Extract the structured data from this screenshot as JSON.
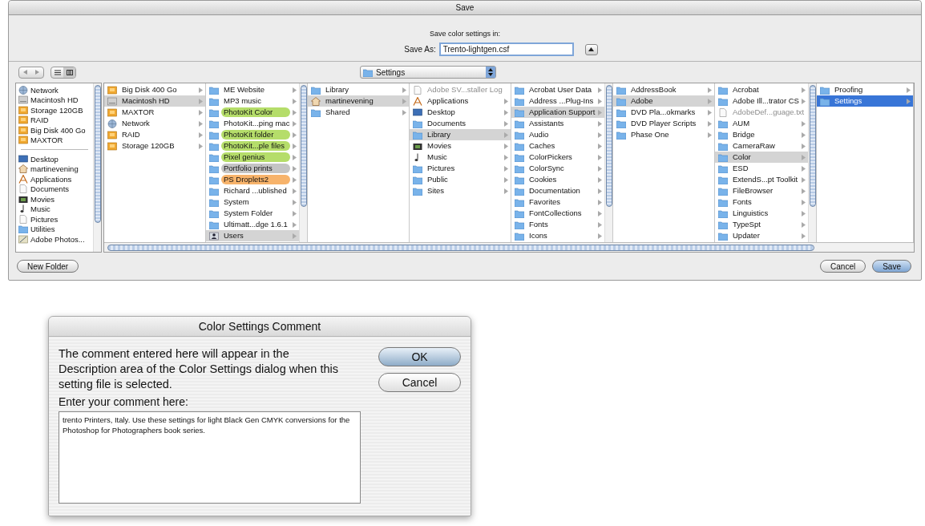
{
  "window": {
    "title": "Save"
  },
  "header": {
    "prompt": "Save color settings in:",
    "save_as_label": "Save As:",
    "filename": "Trento-lightgen.csf"
  },
  "location_popup": {
    "label": "Settings"
  },
  "sidebar": {
    "devices": [
      {
        "name": "Network",
        "kind": "network"
      },
      {
        "name": "Macintosh HD",
        "kind": "disk"
      },
      {
        "name": "Storage 120GB",
        "kind": "drive"
      },
      {
        "name": "RAID",
        "kind": "drive"
      },
      {
        "name": "Big Disk 400 Go",
        "kind": "drive"
      },
      {
        "name": "MAXTOR",
        "kind": "drive"
      }
    ],
    "places": [
      {
        "name": "Desktop",
        "kind": "desktop"
      },
      {
        "name": "martinevening",
        "kind": "home"
      },
      {
        "name": "Applications",
        "kind": "applications"
      },
      {
        "name": "Documents",
        "kind": "file"
      },
      {
        "name": "Movies",
        "kind": "movies"
      },
      {
        "name": "Music",
        "kind": "music"
      },
      {
        "name": "Pictures",
        "kind": "file"
      },
      {
        "name": "Utilities",
        "kind": "folder"
      },
      {
        "name": "Adobe Photos...",
        "kind": "app"
      }
    ]
  },
  "columns": [
    {
      "scrollable": false,
      "items": [
        {
          "name": "Big Disk 400 Go",
          "kind": "drive",
          "selected": false
        },
        {
          "name": "Macintosh HD",
          "kind": "disk",
          "selected": true
        },
        {
          "name": "MAXTOR",
          "kind": "drive",
          "selected": false
        },
        {
          "name": "Network",
          "kind": "network",
          "selected": false
        },
        {
          "name": "RAID",
          "kind": "drive",
          "selected": false
        },
        {
          "name": "Storage 120GB",
          "kind": "drive",
          "selected": false
        }
      ]
    },
    {
      "scrollable": true,
      "items": [
        {
          "name": "ME Website",
          "kind": "folder",
          "selected": false
        },
        {
          "name": "MP3 music",
          "kind": "folder",
          "selected": false
        },
        {
          "name": "PhotoKit Color",
          "kind": "folder",
          "selected": false,
          "color": "#b5dd6a"
        },
        {
          "name": "PhotoKit...ping mac",
          "kind": "folder",
          "selected": false
        },
        {
          "name": "PhotoKit folder",
          "kind": "folder",
          "selected": false,
          "color": "#b5dd6a"
        },
        {
          "name": "PhotoKit...ple files",
          "kind": "folder",
          "selected": false,
          "color": "#b5dd6a"
        },
        {
          "name": "Pixel genius",
          "kind": "folder",
          "selected": false,
          "color": "#b5dd6a"
        },
        {
          "name": "Portfolio prints",
          "kind": "folder",
          "selected": false,
          "color": "#c4c4c4"
        },
        {
          "name": "PS Droplets2",
          "kind": "folder",
          "selected": false,
          "color": "#f7b36b"
        },
        {
          "name": "Richard ...ublished",
          "kind": "folder",
          "selected": false
        },
        {
          "name": "System",
          "kind": "folder",
          "selected": false
        },
        {
          "name": "System Folder",
          "kind": "folder",
          "selected": false
        },
        {
          "name": "Ultimatt...dge 1.6.1",
          "kind": "folder",
          "selected": false
        },
        {
          "name": "Users",
          "kind": "users",
          "selected": true
        }
      ]
    },
    {
      "scrollable": false,
      "items": [
        {
          "name": "Library",
          "kind": "folder",
          "selected": false
        },
        {
          "name": "martinevening",
          "kind": "home",
          "selected": true
        },
        {
          "name": "Shared",
          "kind": "folder",
          "selected": false
        }
      ]
    },
    {
      "scrollable": false,
      "items": [
        {
          "name": "Adobe SV...staller Log",
          "kind": "file",
          "selected": false
        },
        {
          "name": "Applications",
          "kind": "applications",
          "selected": false
        },
        {
          "name": "Desktop",
          "kind": "desktop",
          "selected": false
        },
        {
          "name": "Documents",
          "kind": "folder",
          "selected": false
        },
        {
          "name": "Library",
          "kind": "folder",
          "selected": true
        },
        {
          "name": "Movies",
          "kind": "movies",
          "selected": false
        },
        {
          "name": "Music",
          "kind": "music",
          "selected": false
        },
        {
          "name": "Pictures",
          "kind": "folder",
          "selected": false
        },
        {
          "name": "Public",
          "kind": "folder",
          "selected": false
        },
        {
          "name": "Sites",
          "kind": "folder",
          "selected": false
        }
      ]
    },
    {
      "scrollable": true,
      "items": [
        {
          "name": "Acrobat User Data",
          "kind": "folder",
          "selected": false
        },
        {
          "name": "Address ...Plug-Ins",
          "kind": "folder",
          "selected": false
        },
        {
          "name": "Application Support",
          "kind": "folder",
          "selected": true
        },
        {
          "name": "Assistants",
          "kind": "folder",
          "selected": false
        },
        {
          "name": "Audio",
          "kind": "folder",
          "selected": false
        },
        {
          "name": "Caches",
          "kind": "folder",
          "selected": false
        },
        {
          "name": "ColorPickers",
          "kind": "folder",
          "selected": false
        },
        {
          "name": "ColorSync",
          "kind": "folder",
          "selected": false
        },
        {
          "name": "Cookies",
          "kind": "folder",
          "selected": false
        },
        {
          "name": "Documentation",
          "kind": "folder",
          "selected": false
        },
        {
          "name": "Favorites",
          "kind": "folder",
          "selected": false
        },
        {
          "name": "FontCollections",
          "kind": "folder",
          "selected": false
        },
        {
          "name": "Fonts",
          "kind": "folder",
          "selected": false
        },
        {
          "name": "Icons",
          "kind": "folder",
          "selected": false
        }
      ]
    },
    {
      "scrollable": false,
      "items": [
        {
          "name": "AddressBook",
          "kind": "folder",
          "selected": false
        },
        {
          "name": "Adobe",
          "kind": "folder",
          "selected": true
        },
        {
          "name": "DVD Pla...okmarks",
          "kind": "folder",
          "selected": false
        },
        {
          "name": "DVD Player Scripts",
          "kind": "folder",
          "selected": false
        },
        {
          "name": "Phase One",
          "kind": "folder",
          "selected": false
        }
      ]
    },
    {
      "scrollable": true,
      "items": [
        {
          "name": "Acrobat",
          "kind": "folder",
          "selected": false
        },
        {
          "name": "Adobe Ill...trator CS",
          "kind": "folder",
          "selected": false
        },
        {
          "name": "AdobeDef...guage.txt",
          "kind": "file",
          "selected": false
        },
        {
          "name": "AUM",
          "kind": "folder",
          "selected": false
        },
        {
          "name": "Bridge",
          "kind": "folder",
          "selected": false
        },
        {
          "name": "CameraRaw",
          "kind": "folder",
          "selected": false
        },
        {
          "name": "Color",
          "kind": "folder",
          "selected": true
        },
        {
          "name": "ESD",
          "kind": "folder",
          "selected": false
        },
        {
          "name": "ExtendS...pt Toolkit",
          "kind": "folder",
          "selected": false
        },
        {
          "name": "FileBrowser",
          "kind": "folder",
          "selected": false
        },
        {
          "name": "Fonts",
          "kind": "folder",
          "selected": false
        },
        {
          "name": "Linguistics",
          "kind": "folder",
          "selected": false
        },
        {
          "name": "TypeSpt",
          "kind": "folder",
          "selected": false
        },
        {
          "name": "Updater",
          "kind": "folder",
          "selected": false
        }
      ]
    },
    {
      "scrollable": false,
      "items": [
        {
          "name": "Proofing",
          "kind": "folder",
          "selected": false
        },
        {
          "name": "Settings",
          "kind": "folder",
          "selected": true
        }
      ]
    }
  ],
  "buttons": {
    "new_folder": "New Folder",
    "cancel": "Cancel",
    "save": "Save"
  },
  "comment_dialog": {
    "title": "Color Settings Comment",
    "message": "The comment entered here will appear in the Description area of the Color Settings dialog when this setting file is selected.",
    "field_label": "Enter your comment here:",
    "comment": "trento Printers, Italy. Use these settings for light Black Gen CMYK conversions for the Photoshop for Photographers book series.",
    "buttons": [
      {
        "label": "OK",
        "default": true
      },
      {
        "label": "Cancel",
        "default": false
      }
    ]
  }
}
